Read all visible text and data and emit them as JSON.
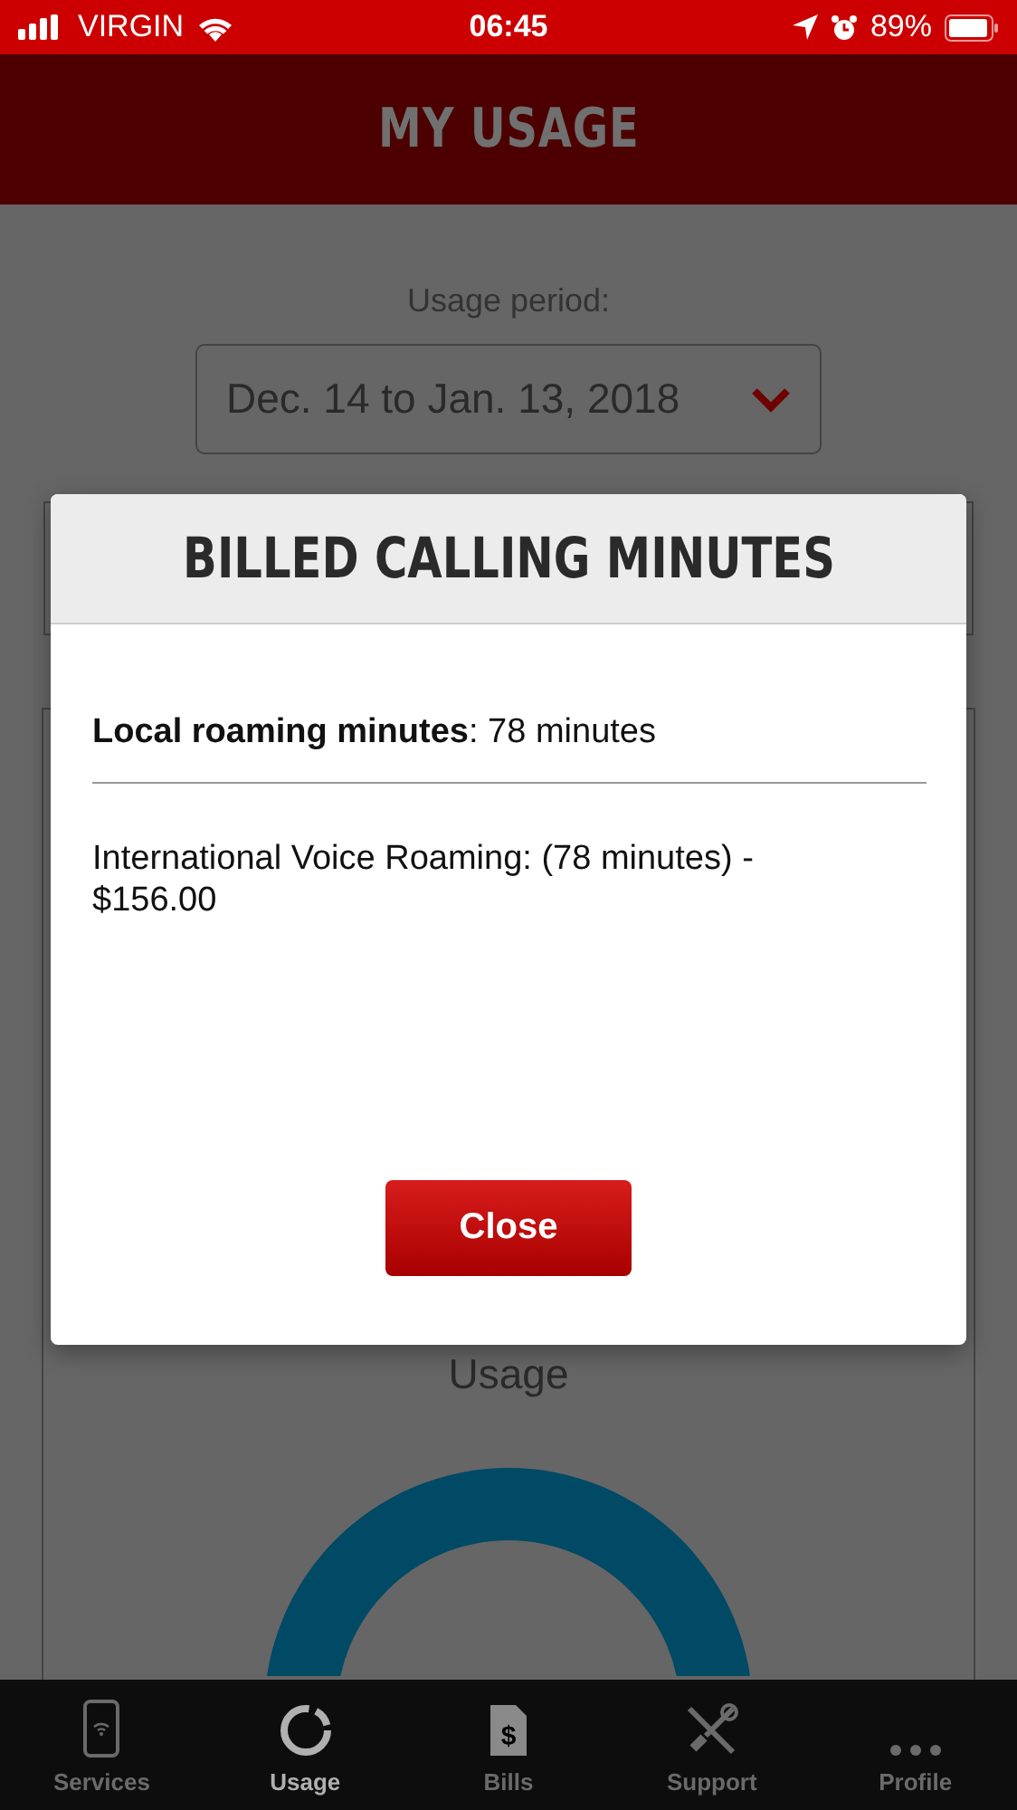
{
  "status_bar": {
    "carrier": "VIRGIN",
    "time": "06:45",
    "battery": "89%"
  },
  "header": {
    "title": "MY USAGE"
  },
  "usage_period": {
    "label": "Usage period:",
    "value": "Dec. 14 to Jan. 13, 2018"
  },
  "usage_card": {
    "title": "Usage"
  },
  "dialog": {
    "title": "BILLED CALLING MINUTES",
    "lines": [
      "**Local roaming minutes**: 78 minutes",
      "International Voice Roaming: (78 minutes) - $156.00"
    ],
    "button": "Close"
  },
  "tabs": [
    {
      "label": "Services",
      "kind": "phone",
      "selected": false
    },
    {
      "label": "Usage",
      "kind": "donut",
      "selected": true
    },
    {
      "label": "Bills",
      "kind": "bill",
      "icon_symbol": "$",
      "selected": false
    },
    {
      "label": "Support",
      "kind": "tools",
      "selected": false
    },
    {
      "label": "Profile",
      "kind": "more",
      "selected": false
    }
  ]
}
